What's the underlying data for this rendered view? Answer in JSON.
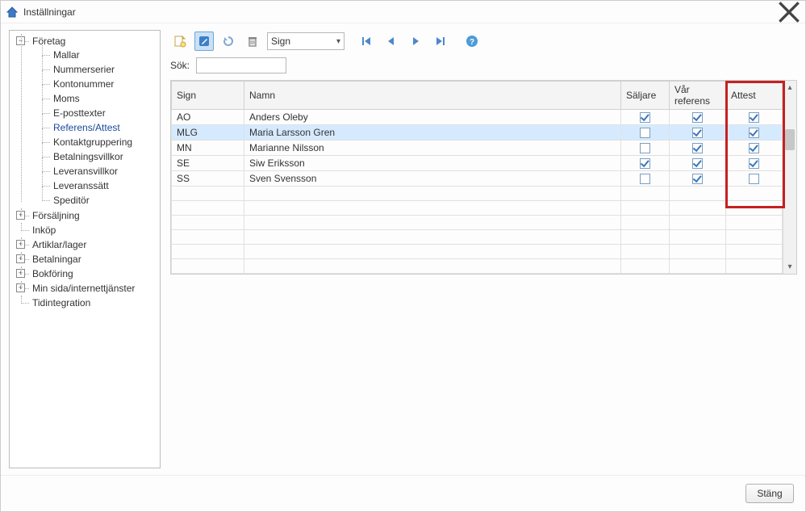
{
  "window": {
    "title": "Inställningar"
  },
  "tree": {
    "root": "Företag",
    "children": [
      "Mallar",
      "Nummerserier",
      "Kontonummer",
      "Moms",
      "E-posttexter",
      "Referens/Attest",
      "Kontaktgruppering",
      "Betalningsvillkor",
      "Leveransvillkor",
      "Leveranssätt",
      "Speditör"
    ],
    "siblings": [
      "Försäljning",
      "Inköp",
      "Artiklar/lager",
      "Betalningar",
      "Bokföring",
      "Min sida/internettjänster",
      "Tidintegration"
    ],
    "selected": "Referens/Attest"
  },
  "toolbar": {
    "sort_value": "Sign",
    "search_label": "Sök:",
    "search_value": ""
  },
  "grid": {
    "columns": {
      "sign": "Sign",
      "namn": "Namn",
      "saljare": "Säljare",
      "varref": "Vår referens",
      "attest": "Attest"
    },
    "rows": [
      {
        "sign": "AO",
        "namn": "Anders Oleby",
        "saljare": true,
        "varref": true,
        "attest": true,
        "selected": false
      },
      {
        "sign": "MLG",
        "namn": "Maria Larsson Gren",
        "saljare": false,
        "varref": true,
        "attest": true,
        "selected": true
      },
      {
        "sign": "MN",
        "namn": "Marianne Nilsson",
        "saljare": false,
        "varref": true,
        "attest": true,
        "selected": false
      },
      {
        "sign": "SE",
        "namn": "Siw Eriksson",
        "saljare": true,
        "varref": true,
        "attest": true,
        "selected": false
      },
      {
        "sign": "SS",
        "namn": "Sven Svensson",
        "saljare": false,
        "varref": true,
        "attest": false,
        "selected": false
      }
    ],
    "blank_rows": 6
  },
  "footer": {
    "close": "Stäng"
  }
}
